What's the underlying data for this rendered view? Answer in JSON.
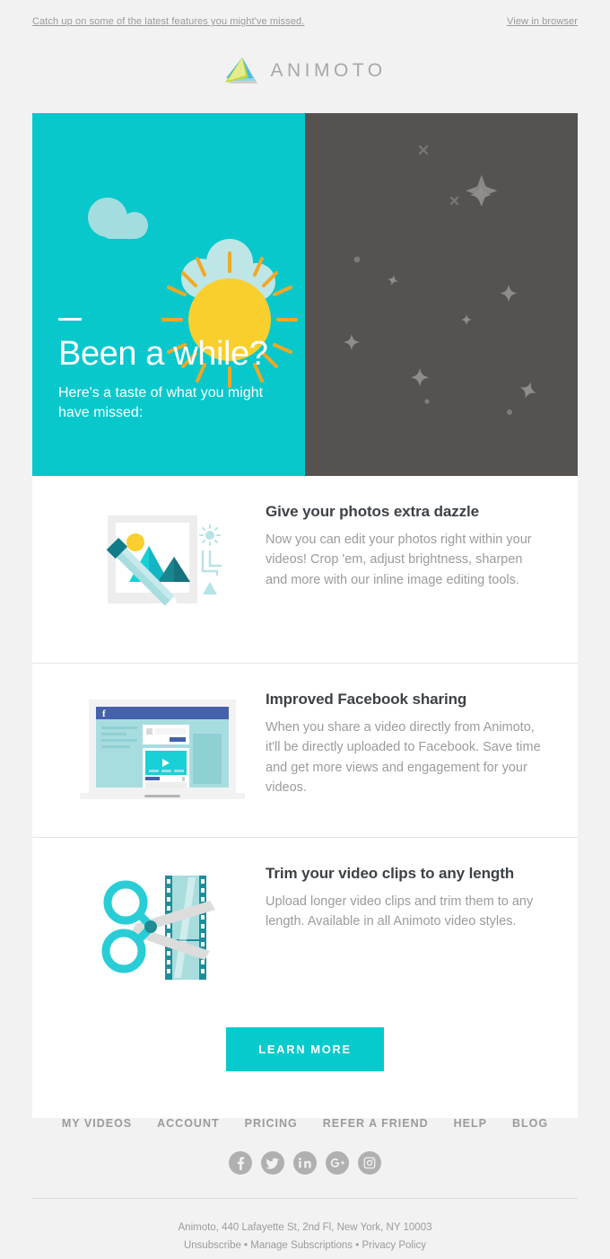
{
  "preheader": {
    "catch_up_link": "Catch up on some of the latest features you might've missed.",
    "view_in_browser_link": "View in browser"
  },
  "brand": {
    "wordmark": "ANIMOTO",
    "logo_icon": "animoto-triangle-logo-icon",
    "colors": {
      "cyan": "#08c8cc",
      "dark": "#555250",
      "logo_green": "#c8dc37",
      "logo_yellow": "#e8ee90",
      "logo_blue": "#4ab8e8",
      "logo_gray": "#cfcfc8",
      "heading": "#3d4247",
      "body_text": "#9b9b9b",
      "page_bg": "#f2f2f2",
      "card_bg": "#ffffff",
      "sun_yellow": "#f9cf2e",
      "sun_ray": "#f0a823",
      "cloud": "#a3dde0"
    }
  },
  "hero": {
    "title": "Been a while?",
    "subtitle": "Here's a taste of what you might have missed:",
    "left_art": "sun-and-cloud-daytime-illustration",
    "right_art": "stars-night-sky-illustration"
  },
  "features": [
    {
      "icon": "photo-editing-illustration",
      "title": "Give your photos extra dazzle",
      "body": "Now you can edit your photos right within your videos! Crop 'em, adjust brightness, sharpen and more with our inline image editing tools."
    },
    {
      "icon": "laptop-facebook-share-illustration",
      "title": "Improved Facebook sharing",
      "body": "When you share a video directly from Animoto, it'll be directly uploaded to Facebook. Save time and get more views and engagement for your videos."
    },
    {
      "icon": "scissors-filmstrip-illustration",
      "title": "Trim your video clips to any length",
      "body": "Upload longer video clips and trim them to any length. Available in all Animoto video styles."
    }
  ],
  "cta": {
    "label": "LEARN MORE"
  },
  "footer": {
    "nav": [
      {
        "label": "MY VIDEOS"
      },
      {
        "label": "ACCOUNT"
      },
      {
        "label": "PRICING"
      },
      {
        "label": "REFER A FRIEND"
      },
      {
        "label": "HELP"
      },
      {
        "label": "BLOG"
      }
    ],
    "social": [
      {
        "name": "facebook-icon"
      },
      {
        "name": "twitter-icon"
      },
      {
        "name": "linkedin-icon"
      },
      {
        "name": "googleplus-icon"
      },
      {
        "name": "instagram-icon"
      }
    ],
    "address": "Animoto, 440 Lafayette St, 2nd Fl, New York, NY 10003",
    "legal_links": "Unsubscribe • Manage Subscriptions • Privacy Policy"
  }
}
